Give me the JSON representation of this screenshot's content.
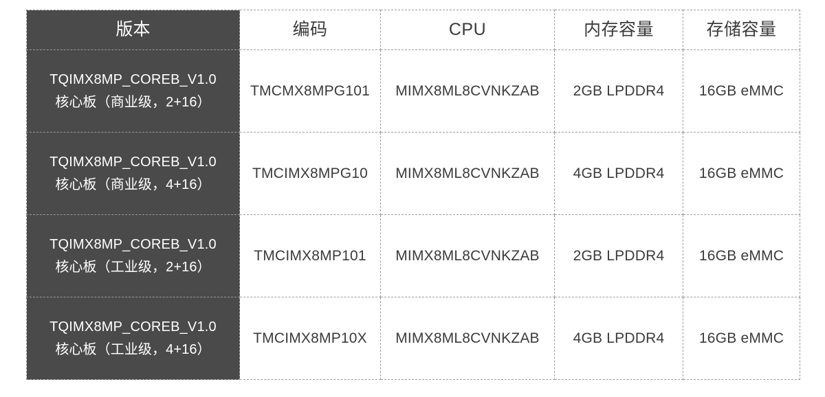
{
  "table": {
    "columns": [
      {
        "key": "version",
        "label": "版本"
      },
      {
        "key": "code",
        "label": "编码"
      },
      {
        "key": "cpu",
        "label": "CPU"
      },
      {
        "key": "memory",
        "label": "内存容量"
      },
      {
        "key": "storage",
        "label": "存储容量"
      }
    ],
    "rows": [
      {
        "version_line1": "TQIMX8MP_COREB_V1.0",
        "version_line2": "核心板（商业级，2+16）",
        "code": "TMCMX8MPG101",
        "cpu": "MIMX8ML8CVNKZAB",
        "memory": "2GB LPDDR4",
        "storage": "16GB eMMC"
      },
      {
        "version_line1": "TQIMX8MP_COREB_V1.0",
        "version_line2": "核心板（商业级，4+16）",
        "code": "TMCIMX8MPG10",
        "cpu": "MIMX8ML8CVNKZAB",
        "memory": "4GB LPDDR4",
        "storage": "16GB eMMC"
      },
      {
        "version_line1": "TQIMX8MP_COREB_V1.0",
        "version_line2": "核心板（工业级，2+16）",
        "code": "TMCIMX8MP101",
        "cpu": "MIMX8ML8CVNKZAB",
        "memory": "2GB LPDDR4",
        "storage": "16GB eMMC"
      },
      {
        "version_line1": "TQIMX8MP_COREB_V1.0",
        "version_line2": "核心板（工业级，4+16）",
        "code": "TMCIMX8MP10X",
        "cpu": "MIMX8ML8CVNKZAB",
        "memory": "4GB LPDDR4",
        "storage": "16GB eMMC"
      }
    ]
  },
  "colors": {
    "version_column_background": "#4a4a4a",
    "version_column_text": "#ffffff",
    "body_text": "#3b3b3b",
    "border": "#9a9a9a",
    "page_background": "#ffffff"
  }
}
